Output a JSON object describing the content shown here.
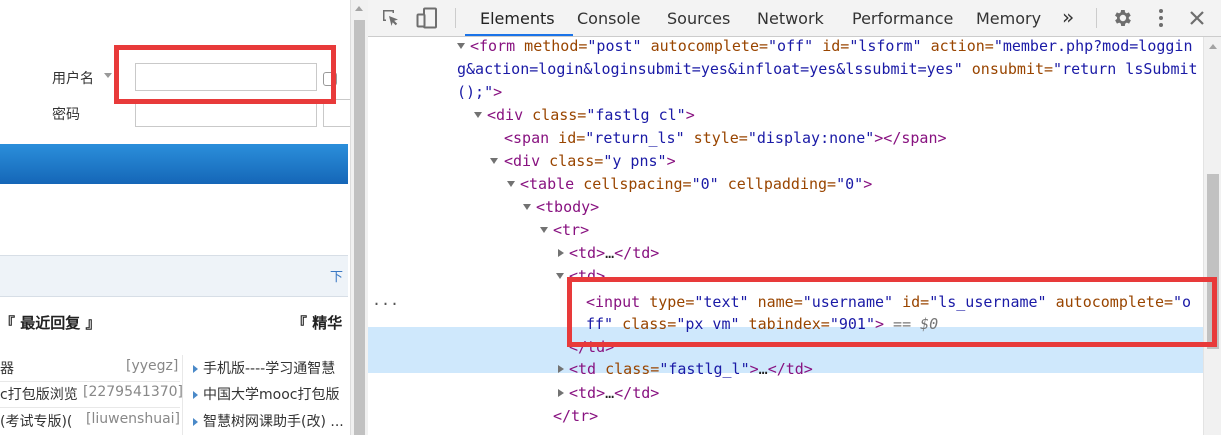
{
  "page": {
    "login": {
      "username_label": "用户名",
      "password_label": "密码",
      "username_value": ""
    },
    "more_link": "下",
    "recent_header": "『 最近回复 』",
    "featured_header": "『 精华",
    "left_rows": [
      {
        "title": "器",
        "user": "[yyegz]"
      },
      {
        "title": "c打包版浏览",
        "user": "[2279541370]"
      },
      {
        "title": "(考试专版)(",
        "user": "[liuwenshuai]"
      }
    ],
    "right_rows": [
      "手机版----学习通智慧",
      "中国大学mooc打包版",
      "智慧树网课助手(改) ..."
    ]
  },
  "devtools": {
    "tabs": [
      "Elements",
      "Console",
      "Sources",
      "Network",
      "Performance",
      "Memory"
    ],
    "active_tab": "Elements",
    "more_tabs": "»",
    "ellipsis": "...",
    "icons": [
      "inspect-element-icon",
      "device-toolbar-icon",
      "settings-gear-icon",
      "more-options-icon",
      "close-icon"
    ],
    "code": {
      "form_line1": {
        "tag": "<form",
        "a1": " method=",
        "v1": "\"post\"",
        "a2": " autocomplete=",
        "v2": "\"off\"",
        "a3": " id=",
        "v3": "\"lsform\"",
        "a4": " action=",
        "v4": "\"member.php?mod=loggin"
      },
      "form_line2": {
        "v4b": "g&action=login&loginsubmit=yes&infloat=yes&lssubmit=yes\"",
        "a5": " onsubmit=",
        "v5": "\"return lsSubmit"
      },
      "form_line3": {
        "v5b": "();\"",
        "close": ">"
      },
      "div_fastlg": {
        "open": "<div",
        "a": " class=",
        "v": "\"fastlg cl\"",
        "close": ">"
      },
      "span_return": {
        "open": "<span",
        "a1": " id=",
        "v1": "\"return_ls\"",
        "a2": " style=",
        "v2": "\"display:none\"",
        "close": "></span>"
      },
      "div_y": {
        "open": "<div",
        "a": " class=",
        "v": "\"y pns\"",
        "close": ">"
      },
      "table": {
        "open": "<table",
        "a1": " cellspacing=",
        "v1": "\"0\"",
        "a2": " cellpadding=",
        "v2": "\"0\"",
        "close": ">"
      },
      "tbody": "<tbody>",
      "tr": "<tr>",
      "td_collapsed": {
        "open": "<td>",
        "dots": "…",
        "close": "</td>"
      },
      "td_open": "<td>",
      "input_line1": {
        "open": "<input",
        "a1": " type=",
        "v1": "\"text\"",
        "a2": " name=",
        "v2": "\"username\"",
        "a3": " id=",
        "v3": "\"ls_username\"",
        "a4": " autocomplete=",
        "v4": "\"o"
      },
      "input_line2": {
        "v4b": "ff\"",
        "a5": " class=",
        "v5": "\"px vm\"",
        "a6": " tabindex=",
        "v6": "\"901\"",
        "close": ">",
        "eq": " == $0"
      },
      "td_close": "</td>",
      "td_fastlg": {
        "open": "<td",
        "a": " class=",
        "v": "\"fastlg_l\"",
        "close": ">",
        "dots": "…",
        "end": "</td>"
      },
      "td_collapsed2": {
        "open": "<td>",
        "dots": "…",
        "close": "</td>"
      },
      "tr_close": "</tr>"
    }
  },
  "colors": {
    "highlight": "#e83a3a",
    "selection": "#cfe8fc",
    "tab_accent": "#1a73e8",
    "tag": "#881280",
    "attr_name": "#994500",
    "attr_value": "#1a1aa6"
  }
}
